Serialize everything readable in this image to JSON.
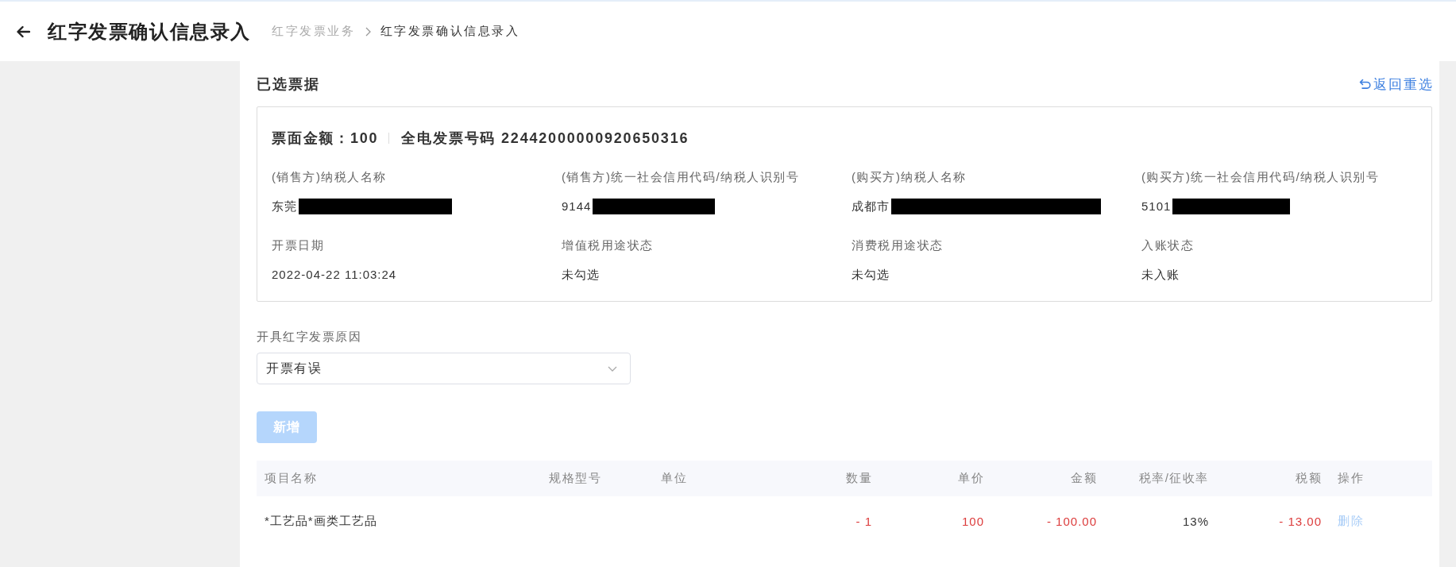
{
  "header": {
    "title": "红字发票确认信息录入",
    "breadcrumb": [
      {
        "label": "红字发票业务",
        "current": false
      },
      {
        "label": "红字发票确认信息录入",
        "current": true
      }
    ]
  },
  "selected_invoice": {
    "title": "已选票据",
    "reselect_link": "返回重选",
    "amount_text": "票面金额：100",
    "number_text": "全电发票号码 22442000000920650316",
    "fields": [
      {
        "label": "(销售方)纳税人名称",
        "value": "东莞",
        "redacted": true
      },
      {
        "label": "(销售方)统一社会信用代码/纳税人识别号",
        "value": "9144",
        "redacted": true
      },
      {
        "label": "(购买方)纳税人名称",
        "value": "成都市",
        "redacted": true
      },
      {
        "label": "(购买方)统一社会信用代码/纳税人识别号",
        "value": "5101",
        "redacted": true
      },
      {
        "label": "开票日期",
        "value": "2022-04-22 11:03:24",
        "redacted": false
      },
      {
        "label": "增值税用途状态",
        "value": "未勾选",
        "redacted": false
      },
      {
        "label": "消费税用途状态",
        "value": "未勾选",
        "redacted": false
      },
      {
        "label": "入账状态",
        "value": "未入账",
        "redacted": false
      }
    ]
  },
  "reason": {
    "label": "开具红字发票原因",
    "value": "开票有误"
  },
  "add_button": {
    "label": "新增",
    "disabled": true
  },
  "table": {
    "columns": [
      "项目名称",
      "规格型号",
      "单位",
      "数量",
      "单价",
      "金额",
      "税率/征收率",
      "税额",
      "操作"
    ],
    "rows": [
      {
        "item_name": {
          "text": "*工艺品*画类工艺品",
          "negative": false
        },
        "quantity": {
          "text": "- 1",
          "negative": true
        },
        "unit_price": {
          "text": "100",
          "negative": true
        },
        "amount": {
          "text": "- 100.00",
          "negative": true
        },
        "tax_rate": {
          "text": "13%",
          "negative": false
        },
        "tax": {
          "text": "- 13.00",
          "negative": true
        },
        "action": {
          "label": "删除",
          "disabled": true
        }
      }
    ]
  }
}
